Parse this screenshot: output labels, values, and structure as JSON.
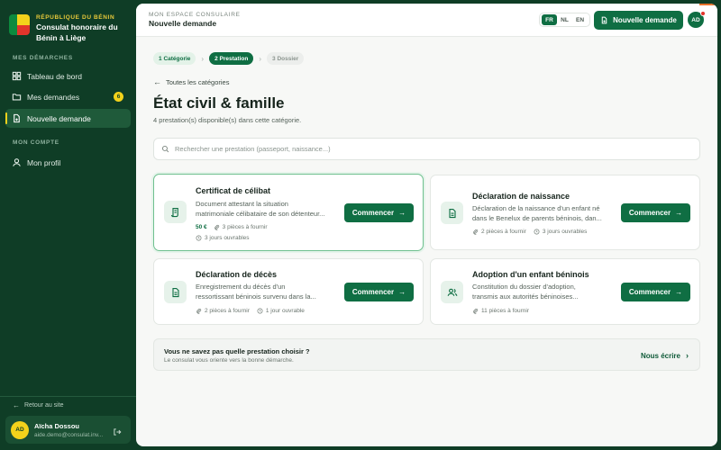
{
  "brand": {
    "country": "RÉPUBLIQUE DU BÉNIN",
    "name_line1": "Consulat honoraire du",
    "name_line2": "Bénin à Liège"
  },
  "sidebar": {
    "section_demarches": "MES DÉMARCHES",
    "items": [
      {
        "label": "Tableau de bord",
        "icon": "dashboard-icon"
      },
      {
        "label": "Mes demandes",
        "icon": "folder-icon",
        "badge": "6"
      },
      {
        "label": "Nouvelle demande",
        "icon": "file-plus-icon",
        "active": true
      }
    ],
    "section_compte": "MON COMPTE",
    "profile_label": "Mon profil",
    "back_label": "Retour au site",
    "user": {
      "initials": "AD",
      "name": "Aïcha Dossou",
      "email": "aide.demo@consulat.inv..."
    }
  },
  "topbar": {
    "kicker": "MON ESPACE CONSULAIRE",
    "title": "Nouvelle demande",
    "languages": [
      "FR",
      "NL",
      "EN"
    ],
    "active_language": "FR",
    "new_request_label": "Nouvelle demande",
    "avatar_initials": "AD"
  },
  "stepper": {
    "steps": [
      {
        "number": "1",
        "label": "Catégorie",
        "state": "done"
      },
      {
        "number": "2",
        "label": "Prestation",
        "state": "current"
      },
      {
        "number": "3",
        "label": "Dossier",
        "state": "todo"
      }
    ]
  },
  "main": {
    "back_label": "Toutes les catégories",
    "title": "État civil & famille",
    "subtitle": "4 prestation(s) disponible(s) dans cette catégorie.",
    "search_placeholder": "Rechercher une prestation (passeport, naissance...)",
    "start_label": "Commencer"
  },
  "services": [
    {
      "title": "Certificat de célibat",
      "desc_line1": "Document attestant la situation",
      "desc_line2": "matrimoniale célibataire de son détenteur...",
      "price": "50 €",
      "pieces": "3 pièces à fournir",
      "delay": "3 jours ouvrables",
      "icon": "scroll-icon",
      "selected": true
    },
    {
      "title": "Déclaration de naissance",
      "desc_line1": "Déclaration de la naissance d'un enfant né",
      "desc_line2": "dans le Benelux de parents béninois, dan...",
      "pieces": "2 pièces à fournir",
      "delay": "3 jours ouvrables",
      "icon": "document-icon"
    },
    {
      "title": "Déclaration de décès",
      "desc_line1": "Enregistrement du décès d'un",
      "desc_line2": "ressortissant béninois survenu dans la...",
      "pieces": "2 pièces à fournir",
      "delay": "1 jour ouvrable",
      "icon": "document-icon"
    },
    {
      "title": "Adoption d'un enfant béninois",
      "desc_line1": "Constitution du dossier d'adoption,",
      "desc_line2": "transmis aux autorités béninoises...",
      "pieces": "11 pièces à fournir",
      "icon": "users-icon"
    }
  ],
  "help": {
    "question": "Vous ne savez pas quelle prestation choisir ?",
    "sub": "Le consulat vous oriente vers la bonne démarche.",
    "link": "Nous écrire"
  },
  "colors": {
    "sidebar_bg": "#0f3d26",
    "primary": "#0f6e43",
    "accent_yellow": "#f3d21b",
    "accent_orange": "#e7722a"
  }
}
